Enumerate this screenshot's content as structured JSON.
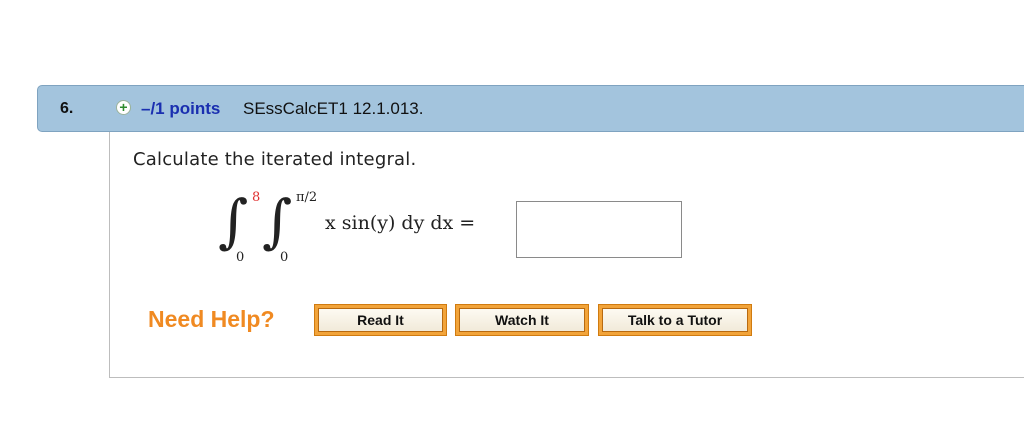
{
  "question": {
    "number": "6.",
    "points": "–/1 points",
    "id": "SEssCalcET1 12.1.013.",
    "prompt": "Calculate the iterated integral.",
    "icons": {
      "expand": "plus-circle-icon"
    }
  },
  "integral": {
    "outer_upper": "8",
    "outer_lower": "0",
    "inner_upper": "π/2",
    "inner_lower": "0",
    "integrand": "x sin(y) dy dx ="
  },
  "answer": {
    "value": ""
  },
  "help": {
    "label": "Need Help?",
    "buttons": [
      "Read It",
      "Watch It",
      "Talk to a Tutor"
    ]
  },
  "colors": {
    "header_bg": "#a3c4dd",
    "points_text": "#1a2fb0",
    "need_help": "#f08a22",
    "button_border": "#f2a43a",
    "red_limit": "#e03030"
  }
}
